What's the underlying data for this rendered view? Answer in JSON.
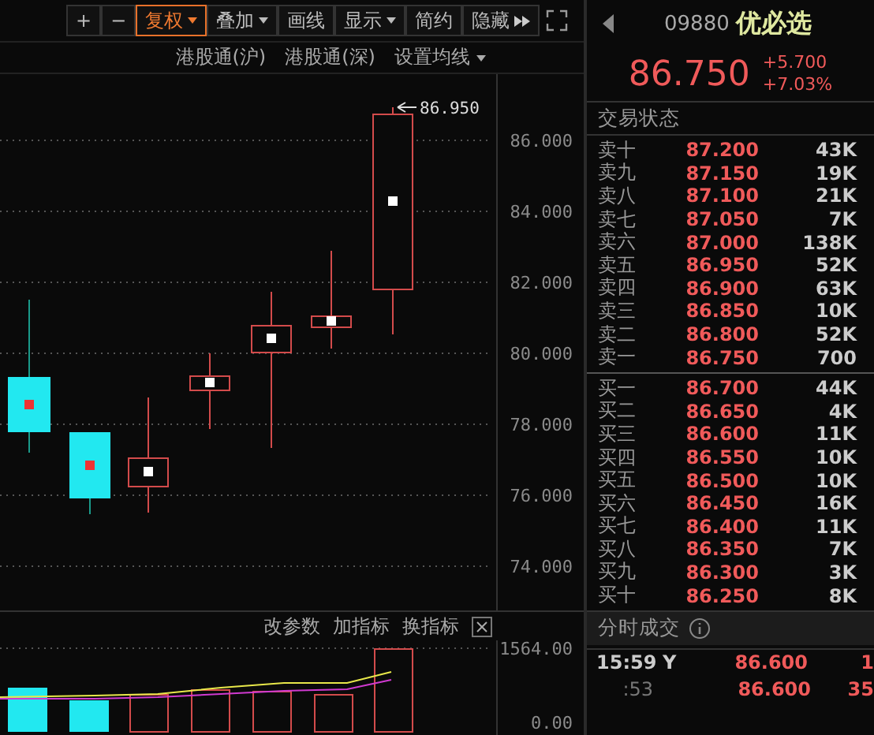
{
  "toolbar": [
    {
      "label": "+",
      "selected": false,
      "dropdown": false
    },
    {
      "label": "−",
      "selected": false,
      "dropdown": false
    },
    {
      "label": "复权",
      "selected": true,
      "dropdown": true
    },
    {
      "label": "叠加",
      "selected": false,
      "dropdown": true
    },
    {
      "label": "画线",
      "selected": false,
      "dropdown": false
    },
    {
      "label": "显示",
      "selected": false,
      "dropdown": true
    },
    {
      "label": "简约",
      "selected": false,
      "dropdown": false
    },
    {
      "label": "隐藏",
      "selected": false,
      "dropdown": false,
      "expand": true
    }
  ],
  "chart_links": [
    {
      "label": "港股通(沪)",
      "dropdown": false
    },
    {
      "label": "港股通(深)",
      "dropdown": false
    },
    {
      "label": "设置均线",
      "dropdown": true
    }
  ],
  "price_chart": {
    "high_label": "86.950",
    "y_labels": [
      "86.000",
      "84.000",
      "82.000",
      "80.000",
      "78.000",
      "76.000",
      "74.000"
    ]
  },
  "indicator_pane": {
    "actions": [
      "改参数",
      "加指标",
      "换指标"
    ],
    "y_labels": [
      "1564.00",
      "0.00"
    ]
  },
  "quote": {
    "code": "09880",
    "name": "优必选",
    "price": "86.750",
    "change": "+5.700",
    "change_pct": "+7.03%",
    "status_label": "交易状态"
  },
  "asks": [
    {
      "label": "卖十",
      "price": "87.200",
      "volume": "43K"
    },
    {
      "label": "卖九",
      "price": "87.150",
      "volume": "19K"
    },
    {
      "label": "卖八",
      "price": "87.100",
      "volume": "21K"
    },
    {
      "label": "卖七",
      "price": "87.050",
      "volume": "7K"
    },
    {
      "label": "卖六",
      "price": "87.000",
      "volume": "138K"
    },
    {
      "label": "卖五",
      "price": "86.950",
      "volume": "52K"
    },
    {
      "label": "卖四",
      "price": "86.900",
      "volume": "63K"
    },
    {
      "label": "卖三",
      "price": "86.850",
      "volume": "10K"
    },
    {
      "label": "卖二",
      "price": "86.800",
      "volume": "52K"
    },
    {
      "label": "卖一",
      "price": "86.750",
      "volume": "700"
    }
  ],
  "bids": [
    {
      "label": "买一",
      "price": "86.700",
      "volume": "44K"
    },
    {
      "label": "买二",
      "price": "86.650",
      "volume": "4K"
    },
    {
      "label": "买三",
      "price": "86.600",
      "volume": "11K"
    },
    {
      "label": "买四",
      "price": "86.550",
      "volume": "10K"
    },
    {
      "label": "买五",
      "price": "86.500",
      "volume": "10K"
    },
    {
      "label": "买六",
      "price": "86.450",
      "volume": "16K"
    },
    {
      "label": "买七",
      "price": "86.400",
      "volume": "11K"
    },
    {
      "label": "买八",
      "price": "86.350",
      "volume": "7K"
    },
    {
      "label": "买九",
      "price": "86.300",
      "volume": "3K"
    },
    {
      "label": "买十",
      "price": "86.250",
      "volume": "8K"
    }
  ],
  "trades": {
    "title": "分时成交",
    "rows": [
      {
        "time": "15:59",
        "flag": "Y",
        "price": "86.600",
        "volume": "1"
      },
      {
        "time": ":53",
        "price": "86.600",
        "volume": "35"
      }
    ]
  }
}
